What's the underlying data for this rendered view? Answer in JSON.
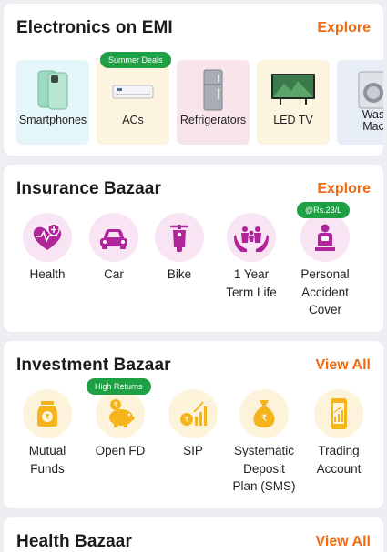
{
  "electronics": {
    "title": "Electronics on EMI",
    "action": "Explore",
    "badge": "Summer Deals",
    "items": [
      {
        "label": "Smartphones",
        "icon": "smartphone-icon",
        "bg": "#e4f6fa"
      },
      {
        "label": "ACs",
        "icon": "air-conditioner-icon",
        "bg": "#fdf4e0"
      },
      {
        "label": "Refrigerators",
        "icon": "refrigerator-icon",
        "bg": "#f8e5ec"
      },
      {
        "label": "LED TV",
        "icon": "television-icon",
        "bg": "#fdf4e0"
      },
      {
        "label": "Was\nMac",
        "icon": "washing-machine-icon",
        "bg": "#e7edf7"
      }
    ]
  },
  "insurance": {
    "title": "Insurance Bazaar",
    "action": "Explore",
    "badge": "@Rs.23/L",
    "items": [
      {
        "label": "Health",
        "icon": "heart-shield-icon"
      },
      {
        "label": "Car",
        "icon": "car-icon"
      },
      {
        "label": "Bike",
        "icon": "scooter-icon"
      },
      {
        "label": "1 Year\nTerm Life",
        "icon": "family-hands-icon"
      },
      {
        "label": "Personal\nAccident\nCover",
        "icon": "injured-person-icon"
      }
    ]
  },
  "investment": {
    "title": "Investment Bazaar",
    "action": "View All",
    "badge": "High Returns",
    "items": [
      {
        "label": "Mutual\nFunds",
        "icon": "coin-jar-icon"
      },
      {
        "label": "Open FD",
        "icon": "piggy-bank-icon"
      },
      {
        "label": "SIP",
        "icon": "coins-growth-icon"
      },
      {
        "label": "Systematic\nDeposit\nPlan (SMS)",
        "icon": "money-bag-icon"
      },
      {
        "label": "Trading\nAccount",
        "icon": "phone-chart-icon"
      }
    ]
  },
  "health": {
    "title": "Health Bazaar",
    "action": "View All"
  },
  "colors": {
    "accent": "#f26a10",
    "insurance_icon": "#b0269a",
    "insurance_bg": "#f8e4f2",
    "investment_icon": "#f5b41c",
    "investment_bg": "#fdf3db",
    "badge": "#1fa045"
  }
}
